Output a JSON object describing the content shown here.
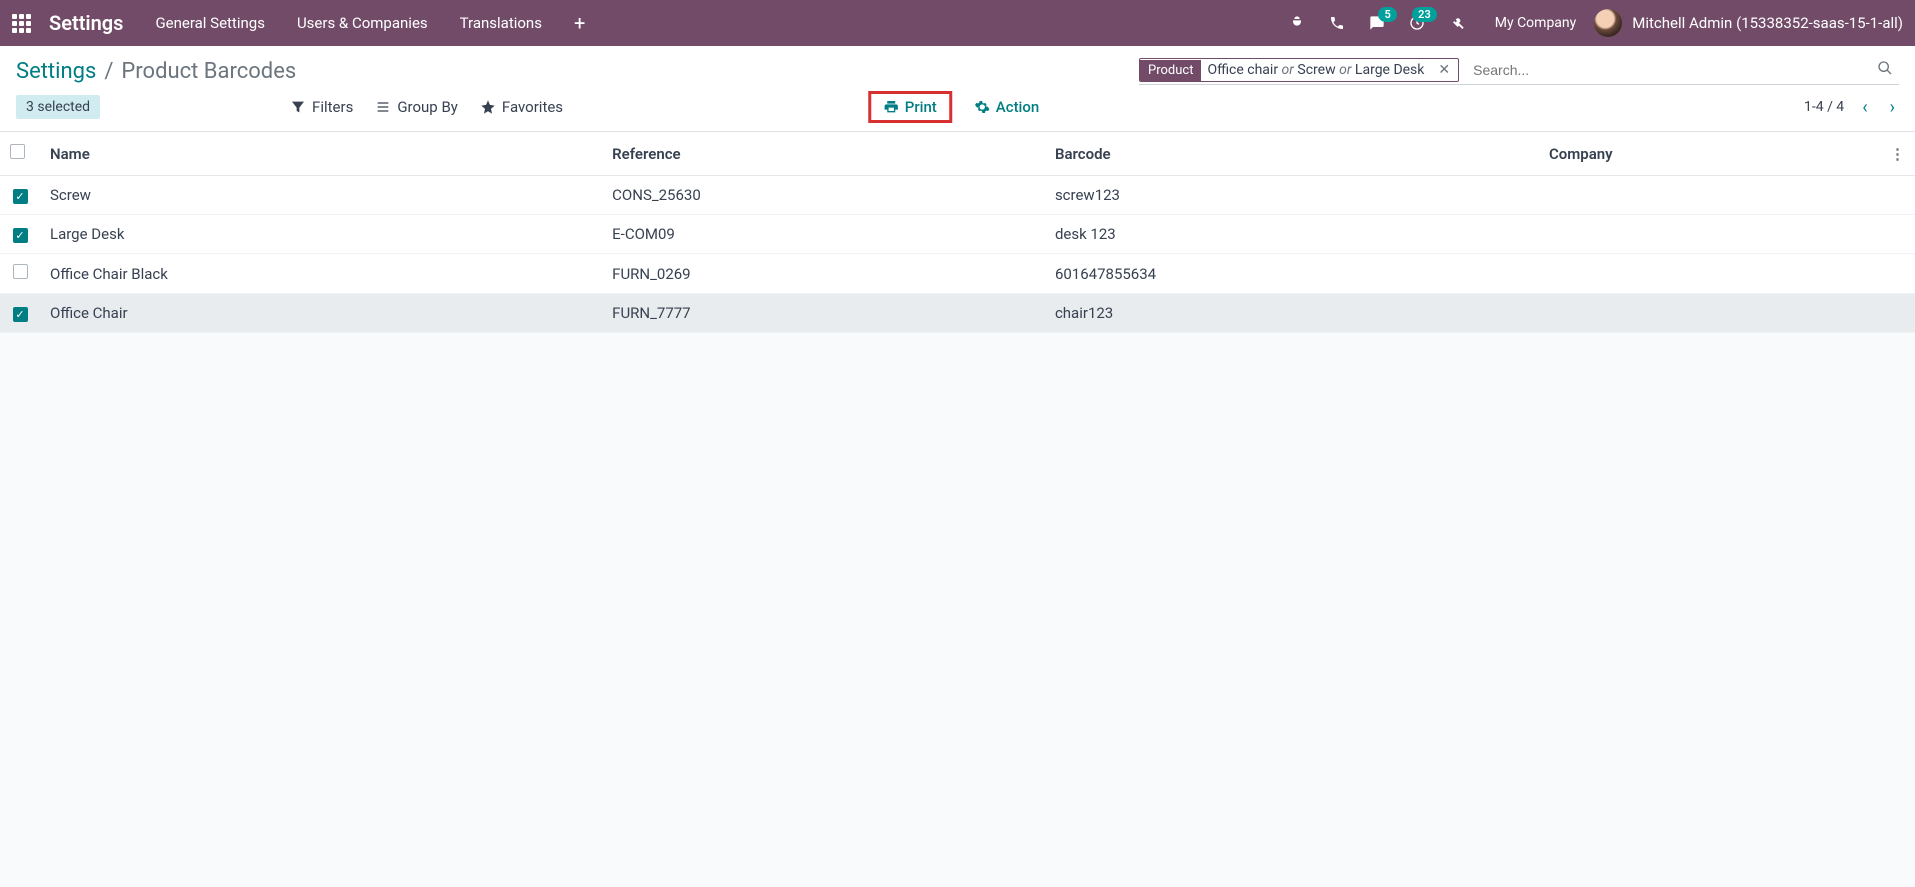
{
  "topbar": {
    "app_title": "Settings",
    "nav": [
      "General Settings",
      "Users & Companies",
      "Translations"
    ],
    "discuss_badge": "5",
    "activities_badge": "23",
    "company": "My Company",
    "user": "Mitchell Admin (15338352-saas-15-1-all)"
  },
  "breadcrumb": {
    "root": "Settings",
    "separator": "/",
    "current": "Product Barcodes"
  },
  "search": {
    "facet_label": "Product",
    "facet_v1": "Office chair",
    "facet_or1": "or",
    "facet_v2": "Screw",
    "facet_or2": "or",
    "facet_v3": "Large Desk",
    "placeholder": "Search..."
  },
  "actions": {
    "selected_text": "3 selected",
    "print": "Print",
    "action": "Action",
    "filters": "Filters",
    "group_by": "Group By",
    "favorites": "Favorites",
    "pager": "1-4 / 4"
  },
  "columns": {
    "name": "Name",
    "reference": "Reference",
    "barcode": "Barcode",
    "company": "Company"
  },
  "rows": [
    {
      "checked": true,
      "name": "Screw",
      "reference": "CONS_25630",
      "barcode": "screw123",
      "company": "",
      "highlighted": false
    },
    {
      "checked": true,
      "name": "Large Desk",
      "reference": "E-COM09",
      "barcode": "desk 123",
      "company": "",
      "highlighted": false
    },
    {
      "checked": false,
      "name": "Office Chair Black",
      "reference": "FURN_0269",
      "barcode": "601647855634",
      "company": "",
      "highlighted": false
    },
    {
      "checked": true,
      "name": "Office Chair",
      "reference": "FURN_7777",
      "barcode": "chair123",
      "company": "",
      "highlighted": true
    }
  ]
}
